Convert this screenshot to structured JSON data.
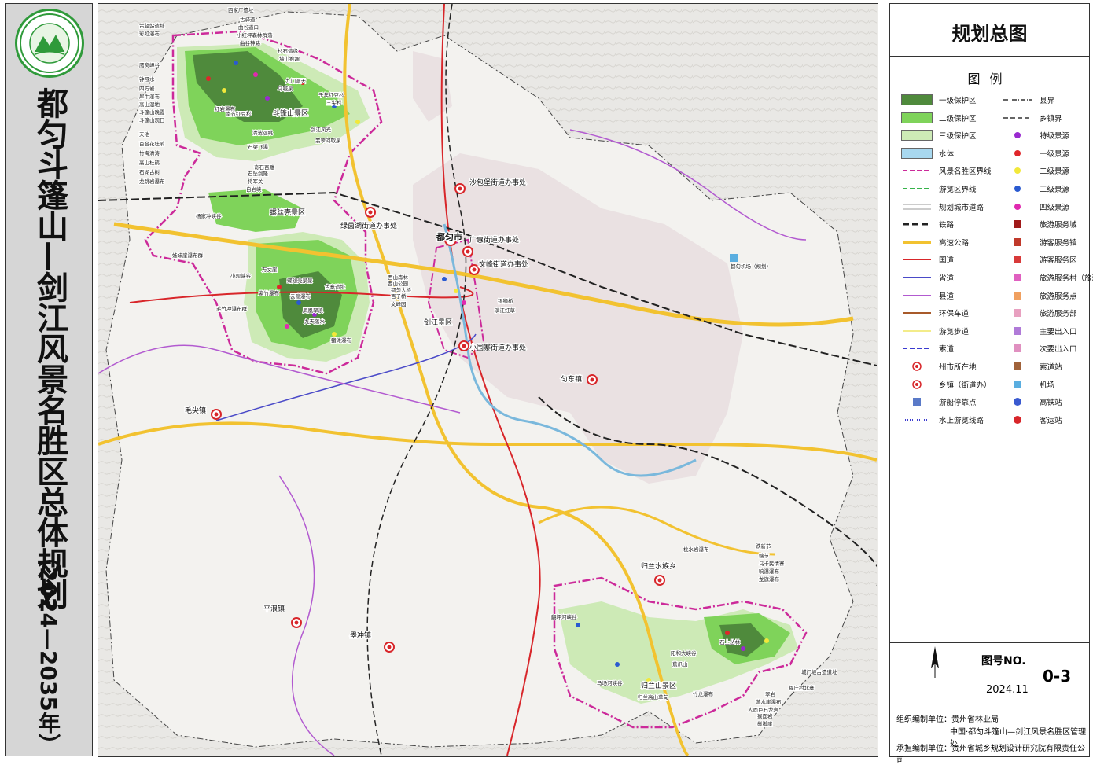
{
  "title": "都匀斗篷山—剑江风景名胜区总体规划",
  "years": "（2024—2035年）",
  "legend": {
    "title": "规划总图",
    "heading": "图例",
    "left": [
      {
        "label": "一级保护区",
        "color": "#4f8a3c",
        "icon": "fill-box"
      },
      {
        "label": "二级保护区",
        "color": "#7fd35a",
        "icon": "fill-box"
      },
      {
        "label": "三级保护区",
        "color": "#cdeab6",
        "icon": "fill-box"
      },
      {
        "label": "水体",
        "color": "#a8d8ef",
        "icon": "fill-box"
      },
      {
        "label": "风景名胜区界线",
        "color": "#cc2a9a",
        "icon": "dash-line"
      },
      {
        "label": "游览区界线",
        "color": "#36b34a",
        "icon": "dash-line"
      },
      {
        "label": "规划城市道路",
        "color": "#999999",
        "icon": "double-line"
      },
      {
        "label": "铁路",
        "color": "#222222",
        "icon": "rail-line"
      },
      {
        "label": "高速公路",
        "color": "#f2c230",
        "icon": "thick-line"
      },
      {
        "label": "国道",
        "color": "#d8262a",
        "icon": "line"
      },
      {
        "label": "省道",
        "color": "#4a4ac8",
        "icon": "line"
      },
      {
        "label": "县道",
        "color": "#b25ad0",
        "icon": "line"
      },
      {
        "label": "环保车道",
        "color": "#a85a2a",
        "icon": "line"
      },
      {
        "label": "游览步道",
        "color": "#f3ec8a",
        "icon": "line"
      },
      {
        "label": "索道",
        "color": "#3a3ad0",
        "icon": "dash-line"
      },
      {
        "label": "州市所在地",
        "color": "#d8262a",
        "icon": "target-circle"
      },
      {
        "label": "乡镇（街道办）",
        "color": "#d8262a",
        "icon": "target-circle"
      },
      {
        "label": "游船停靠点",
        "color": "#5a7ac8",
        "icon": "square-icon"
      },
      {
        "label": "水上游览线路",
        "color": "#3a3ad0",
        "icon": "dot-line"
      }
    ],
    "right": [
      {
        "label": "县界",
        "color": "#333333",
        "icon": "dash-dot-line"
      },
      {
        "label": "乡镇界",
        "color": "#666666",
        "icon": "dash-line"
      },
      {
        "label": "特级景源",
        "color": "#9a2ad0",
        "icon": "dot"
      },
      {
        "label": "一级景源",
        "color": "#e0262a",
        "icon": "dot"
      },
      {
        "label": "二级景源",
        "color": "#f2e83a",
        "icon": "dot"
      },
      {
        "label": "三级景源",
        "color": "#2a5ad0",
        "icon": "dot"
      },
      {
        "label": "四级景源",
        "color": "#e02ab0",
        "icon": "dot"
      },
      {
        "label": "旅游服务城",
        "color": "#a01a1a",
        "icon": "square-icon"
      },
      {
        "label": "游客服务镇",
        "color": "#c0392b",
        "icon": "square-icon"
      },
      {
        "label": "游客服务区",
        "color": "#d83a3a",
        "icon": "square-icon"
      },
      {
        "label": "旅游服务村（旅游服务中心）",
        "color": "#e060c0",
        "icon": "square-icon"
      },
      {
        "label": "旅游服务点",
        "color": "#f0a060",
        "icon": "square-icon"
      },
      {
        "label": "旅游服务部",
        "color": "#e8a0c0",
        "icon": "square-icon"
      },
      {
        "label": "主要出入口",
        "color": "#b07ad8",
        "icon": "square-icon"
      },
      {
        "label": "次要出入口",
        "color": "#e090c0",
        "icon": "square-icon"
      },
      {
        "label": "索道站",
        "color": "#a0623a",
        "icon": "square-icon"
      },
      {
        "label": "机场",
        "color": "#5aaee0",
        "icon": "square-icon"
      },
      {
        "label": "高铁站",
        "color": "#3a5ad0",
        "icon": "circle-icon"
      },
      {
        "label": "客运站",
        "color": "#d8262a",
        "icon": "circle-icon"
      }
    ]
  },
  "info": {
    "drawing_no_label": "图号NO.",
    "drawing_no": "0-3",
    "date": "2024.11",
    "org_label_1": "组织编制单位：贵州省林业局",
    "org_line_2": "中国·都匀斗篷山—剑江风景名胜区管理处",
    "org_line_3": "承担编制单位：贵州省城乡规划设计研究院有限责任公司"
  },
  "map": {
    "cities": [
      {
        "name": "都匀市"
      },
      {
        "name": "沙包堡街道办事处"
      },
      {
        "name": "绿茵湖街道办事处"
      },
      {
        "name": "广惠街道办事处"
      },
      {
        "name": "文峰街道办事处"
      },
      {
        "name": "小围寨街道办事处"
      },
      {
        "name": "匀东镇"
      },
      {
        "name": "毛尖镇"
      },
      {
        "name": "平浪镇"
      },
      {
        "name": "墨冲镇"
      },
      {
        "name": "归兰水族乡"
      }
    ],
    "areas": [
      {
        "name": "斗篷山景区"
      },
      {
        "name": "螺丝壳景区"
      },
      {
        "name": "剑江景区"
      },
      {
        "name": "归兰山景区"
      }
    ],
    "spots": [
      "古驿站遗址",
      "彩虹瀑布",
      "西家广遗址",
      "古驿道",
      "曲谷道口",
      "小红坪森林群落",
      "曲谷神路",
      "杉石情缘",
      "墙山猴趣",
      "九门洞天",
      "乌喊泉",
      "千年红豆杉",
      "三尖杉",
      "鹰窝嶂谷",
      "钟哑水",
      "四方岩",
      "犀牛瀑布",
      "高山湿地",
      "斗篷山晚霞",
      "斗篷山观日",
      "天池",
      "百合花杜鹃",
      "竹海清涛",
      "高山杜鹃",
      "石湖古树",
      "龙跳岩瀑布",
      "红岩瀑布",
      "南方红豆杉",
      "清波远眺",
      "石梁飞瀑",
      "奇石百雕",
      "石坠剑隆",
      "将军关",
      "自岩峡",
      "剑江风光",
      "翡翠河歇泉",
      "杨家冲峡谷",
      "姊妹崖瀑布群",
      "万丈崖",
      "紫竹瀑布",
      "小观峡谷",
      "蝶翅壳景景",
      "古寨遗址",
      "云隐瀑布",
      "毛竹冲瀑布群",
      "凤凰翠浪",
      "九天落水",
      "猪滩瀑布",
      "西山森林",
      "西山公园",
      "都匀大桥",
      "百子桥",
      "文峰园",
      "银狮桥",
      "滨江红草",
      "都匀机场（规划）",
      "桃水岩瀑布",
      "跌新节",
      "端节",
      "乌卡民情寨",
      "响瀑瀑布",
      "龙旗瀑布",
      "翻坪河峡谷",
      "马场河峡谷",
      "归兰高山草甸",
      "阳和大峡谷",
      "蕉爪山",
      "竹龙瀑布",
      "石上丛林",
      "城门坡古遗道址",
      "福庄村北寨",
      "翠岩",
      "落水崖瀑布",
      "人面巨石龙岩",
      "猴面岩",
      "鬃脚崖"
    ]
  }
}
